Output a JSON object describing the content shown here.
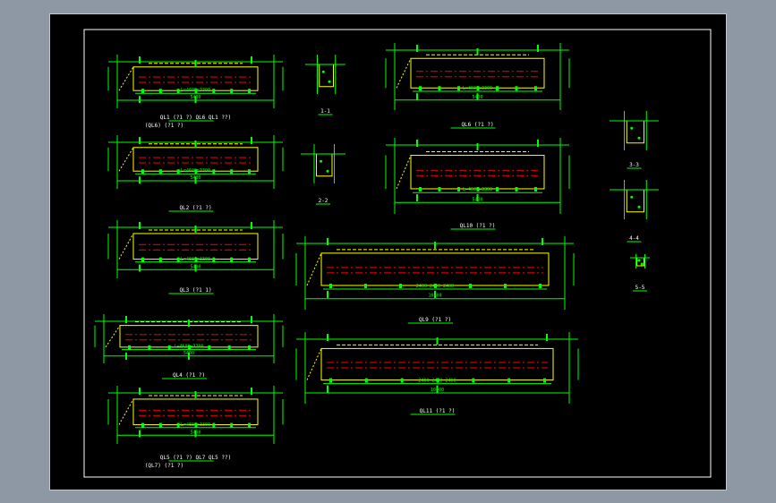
{
  "drawing": {
    "colors": {
      "dim": "#00ff00",
      "concrete": "#ffff00",
      "rebar": "#ff0000",
      "frame": "#ffffff",
      "text": "#ffffff"
    },
    "beams": [
      {
        "id": "QL1",
        "title": "QL1 (?1 ?) QL6 QL1 ??)",
        "subtitle": "(QL6) (?1 ?)",
        "length_label": "5400",
        "span_label": "L=4600=3300"
      },
      {
        "id": "QL2",
        "title": "QL2 (?1 ?)",
        "length_label": "5400",
        "span_label": "L=4600=3300"
      },
      {
        "id": "QL3",
        "title": "QL3 (?1 1)",
        "length_label": "5400",
        "span_label": "L=4600=3300"
      },
      {
        "id": "QL4",
        "title": "QL4 (?1 ?)",
        "length_label": "5400",
        "span_label": "L=4600=3300"
      },
      {
        "id": "QL5",
        "title": "QL5 (?1 ?) QL7 QL5 ??)",
        "subtitle": "(QL7) (?1 ?)",
        "length_label": "5400",
        "span_label": "L=4600=3300"
      },
      {
        "id": "QL6",
        "title": "QL6 (?1 ?)",
        "length_label": "5400",
        "span_label": "L=4600=3300"
      },
      {
        "id": "QL10",
        "title": "QL10 (?1 ?)",
        "length_label": "5400",
        "span_label": "L=4600=3300"
      },
      {
        "id": "QL9",
        "title": "QL9 (?1 ?)",
        "length_label": "10400",
        "span_label": "2400 2400 2400"
      },
      {
        "id": "QL11",
        "title": "QL11 (?1 ?)",
        "length_label": "10400",
        "span_label": "2400 2400 2400"
      }
    ],
    "sections": [
      {
        "id": "1-1",
        "title": "1-1"
      },
      {
        "id": "2-2",
        "title": "2-2"
      },
      {
        "id": "3-3",
        "title": "3-3"
      },
      {
        "id": "4-4",
        "title": "4-4"
      },
      {
        "id": "5-5",
        "title": "5-5"
      }
    ]
  }
}
